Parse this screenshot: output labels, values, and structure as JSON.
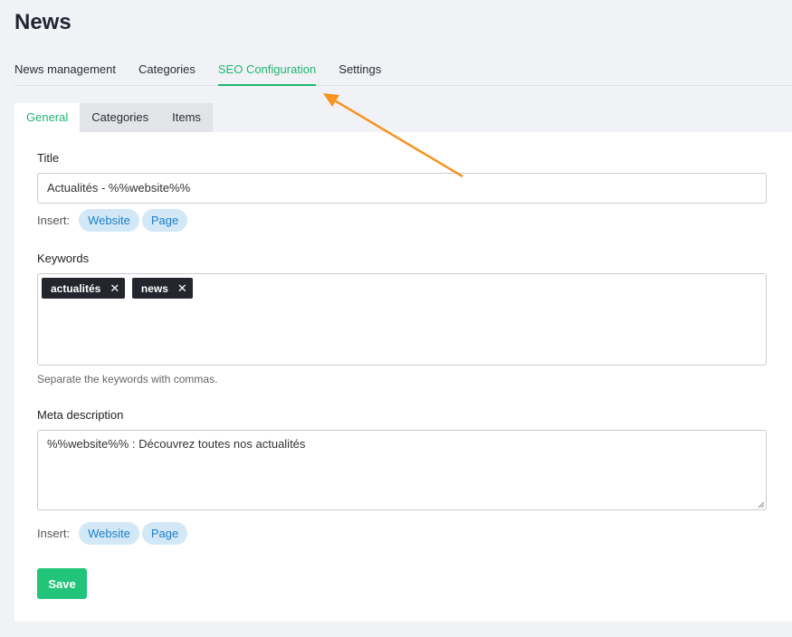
{
  "page_title": "News",
  "top_tabs": [
    "News management",
    "Categories",
    "SEO Configuration",
    "Settings"
  ],
  "active_top_tab": "SEO Configuration",
  "sub_tabs": [
    "General",
    "Categories",
    "Items"
  ],
  "active_sub_tab": "General",
  "form": {
    "title_label": "Title",
    "title_value": "Actualités - %%website%%",
    "insert_label": "Insert:",
    "insert_buttons": [
      "Website",
      "Page"
    ],
    "keywords_label": "Keywords",
    "keywords": [
      "actualités",
      "news"
    ],
    "keyword_remove_glyph": "✕",
    "keywords_help": "Separate the keywords with commas.",
    "meta_label": "Meta description",
    "meta_value": "%%website%% : Découvrez toutes nos actualités",
    "save_label": "Save"
  },
  "colors": {
    "accent_green": "#20b774",
    "save_green": "#22c47a",
    "chip_bg": "#d3e8f7",
    "chip_text": "#1b7fc7",
    "annotation_arrow": "#f7931e"
  }
}
